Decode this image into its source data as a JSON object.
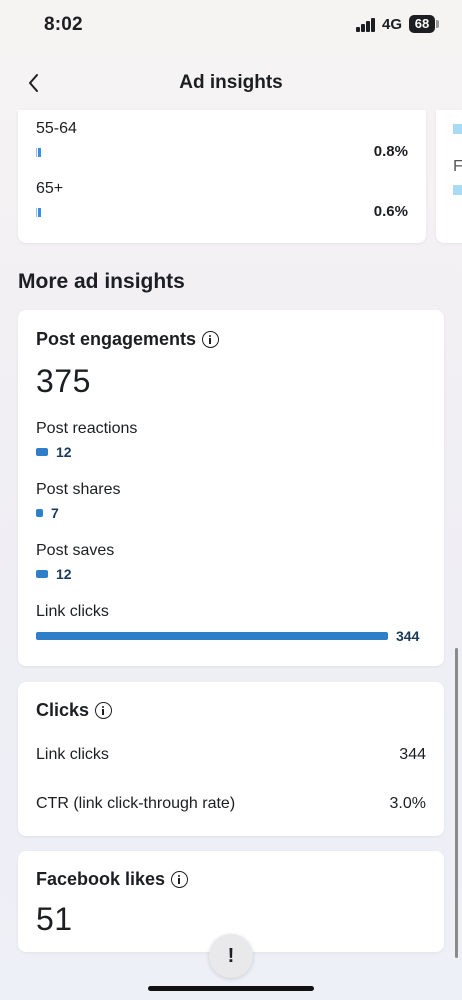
{
  "status_bar": {
    "time": "8:02",
    "network": "4G",
    "battery": "68"
  },
  "header": {
    "title": "Ad insights"
  },
  "age_breakdown": {
    "rows": [
      {
        "label": "55-64",
        "percent": "0.8%"
      },
      {
        "label": "65+",
        "percent": "0.6%"
      }
    ],
    "side_card_letter": "F"
  },
  "section_title": "More ad insights",
  "post_engagements": {
    "title": "Post engagements",
    "total": "375",
    "metrics": [
      {
        "label": "Post reactions",
        "value": "12",
        "fraction": 0.035
      },
      {
        "label": "Post shares",
        "value": "7",
        "fraction": 0.02
      },
      {
        "label": "Post saves",
        "value": "12",
        "fraction": 0.035
      },
      {
        "label": "Link clicks",
        "value": "344",
        "fraction": 1.0
      }
    ]
  },
  "clicks": {
    "title": "Clicks",
    "rows": [
      {
        "label": "Link clicks",
        "value": "344"
      },
      {
        "label": "CTR (link click-through rate)",
        "value": "3.0%"
      }
    ]
  },
  "facebook_likes": {
    "title": "Facebook likes",
    "total": "51"
  },
  "alert_button": {
    "label": "!"
  },
  "colors": {
    "bar": "#2e7fc8",
    "bar_value": "#1a3a5c",
    "accent_light": "#a9dcf4"
  }
}
